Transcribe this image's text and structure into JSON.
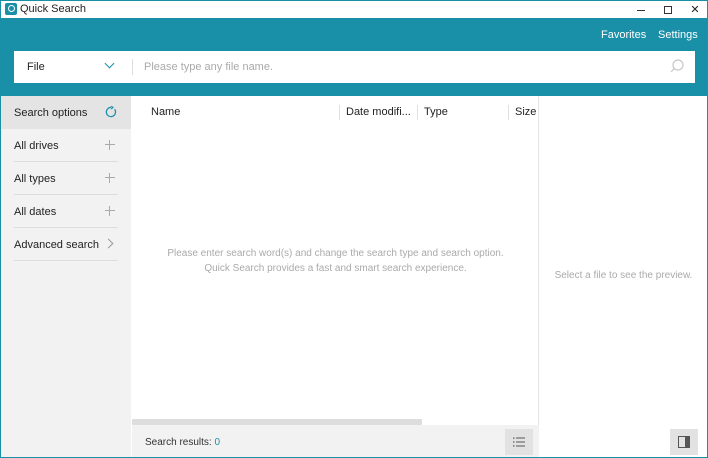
{
  "window": {
    "title": "Quick Search",
    "minimize": "−",
    "maximize": "□",
    "close": "✕"
  },
  "header": {
    "favorites_label": "Favorites",
    "settings_label": "Settings",
    "type_select": "File",
    "search_placeholder": "Please type any file name.",
    "search_value": ""
  },
  "sidebar": {
    "heading": "Search options",
    "items": [
      {
        "label": "All drives",
        "icon": "plus-icon"
      },
      {
        "label": "All types",
        "icon": "plus-icon"
      },
      {
        "label": "All dates",
        "icon": "plus-icon"
      },
      {
        "label": "Advanced search",
        "icon": "chevron-right-icon"
      }
    ]
  },
  "results": {
    "columns": [
      "Name",
      "Date modifi...",
      "Type",
      "Size"
    ],
    "empty_line1": "Please enter search word(s) and change the search type and search option.",
    "empty_line2": "Quick Search provides a fast and smart search experience.",
    "status_label": "Search results:",
    "count": "0"
  },
  "preview": {
    "message": "Select a file to see the preview."
  },
  "colors": {
    "accent": "#1a8fa8",
    "sidebar_bg": "#f2f2f2",
    "muted_text": "#aaaaaa"
  }
}
